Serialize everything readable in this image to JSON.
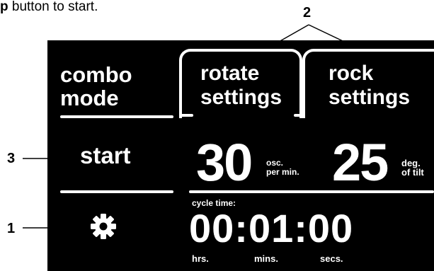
{
  "caption": {
    "bold_text": "p",
    "rest_text": " button to start."
  },
  "callouts": {
    "c1": "1",
    "c2": "2",
    "c3": "3"
  },
  "screen": {
    "combo_line1": "combo",
    "combo_line2": "mode",
    "rotate_line1": "rotate",
    "rotate_line2": "settings",
    "rock_line1": "rock",
    "rock_line2": "settings",
    "start_label": "start",
    "rotate_value": "30",
    "rotate_unit_line1": "osc.",
    "rotate_unit_line2": "per min.",
    "rock_value": "25",
    "rock_unit_line1": "deg.",
    "rock_unit_line2": "of tilt",
    "cycle_time_label": "cycle time:",
    "time_value": "00:01:00",
    "hrs_label": "hrs.",
    "mins_label": "mins.",
    "secs_label": "secs.",
    "settings_icon": "gear-icon"
  }
}
